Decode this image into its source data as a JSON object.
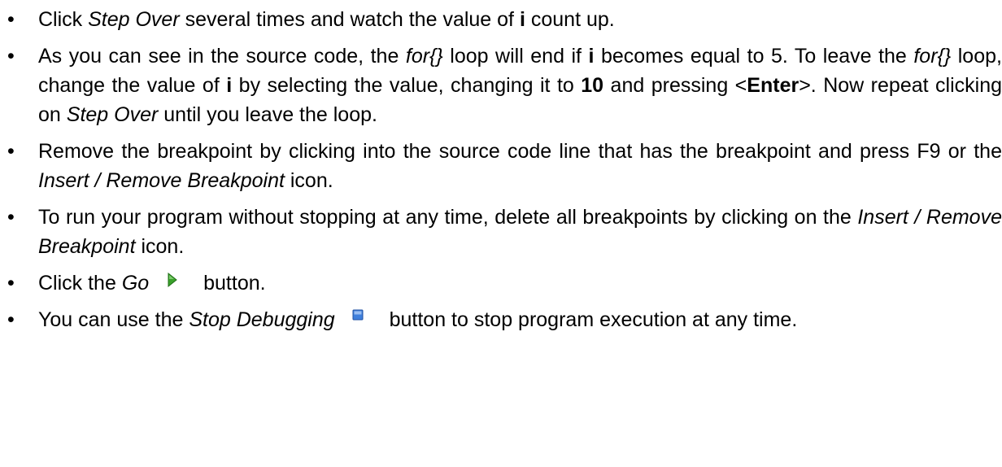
{
  "bullets": [
    {
      "parts": [
        "Click ",
        "Step Over",
        " several times and watch the value of ",
        "i",
        " count up."
      ]
    },
    {
      "parts": [
        "As you can see in the source code, the ",
        "for{}",
        " loop will end if ",
        "i",
        " becomes equal to 5. To leave the ",
        "for{}",
        " loop, change the value of ",
        "i",
        " by selecting the value, changing it to ",
        "10",
        " and pressing <",
        "Enter",
        ">. Now repeat clicking on ",
        "Step Over",
        " until you leave the loop."
      ]
    },
    {
      "parts": [
        "Remove the breakpoint by clicking into the source code line that has the breakpoint and press F9 or the ",
        "Insert / Remove Breakpoint",
        " icon."
      ]
    },
    {
      "parts": [
        "To run your program without stopping at any time, delete all breakpoints by clicking on the ",
        "Insert / Remove Breakpoint",
        " icon."
      ]
    },
    {
      "parts": [
        "Click the ",
        "Go",
        " button."
      ],
      "icon": "go-icon"
    },
    {
      "parts": [
        "You can use the ",
        "Stop Debugging",
        " button to stop program execution at any time."
      ],
      "icon": "stop-debugging-icon"
    }
  ],
  "bullet_glyph": "•",
  "colors": {
    "go_icon": "#3aa12b",
    "stop_icon": "#3f7fdc"
  }
}
